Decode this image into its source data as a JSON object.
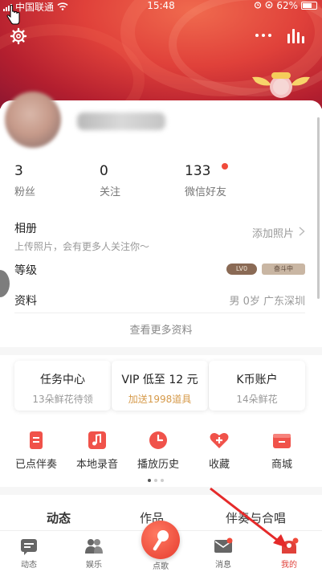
{
  "status": {
    "carrier": "中国联通",
    "time": "15:48",
    "battery": "62%"
  },
  "header": {
    "settings_icon": "gear-icon",
    "more_icon": "more-icon",
    "chart_icon": "bar-chart-icon",
    "badge_icon": "vip-wings-badge-icon"
  },
  "stats": [
    {
      "value": "3",
      "label": "粉丝"
    },
    {
      "value": "0",
      "label": "关注"
    },
    {
      "value": "133",
      "label": "微信好友"
    }
  ],
  "album": {
    "title": "相册",
    "subtitle": "上传照片，会有更多人关注你～",
    "action": "添加照片"
  },
  "level": {
    "title": "等级",
    "level_badge": "LV0",
    "status_badge": "奋斗中"
  },
  "profile": {
    "title": "资料",
    "value": "男 0岁 广东深圳"
  },
  "more_info": "查看更多资料",
  "task_cards": [
    {
      "title": "任务中心",
      "subtitle": "13朵鲜花待领"
    },
    {
      "title": "VIP 低至 12 元",
      "subtitle": "加送1998道具"
    },
    {
      "title": "K币账户",
      "subtitle": "14朵鲜花"
    }
  ],
  "functions": [
    {
      "label": "已点伴奏",
      "icon": "document-icon"
    },
    {
      "label": "本地录音",
      "icon": "music-note-icon"
    },
    {
      "label": "播放历史",
      "icon": "clock-icon"
    },
    {
      "label": "收藏",
      "icon": "heart-plus-icon"
    },
    {
      "label": "商城",
      "icon": "store-icon"
    }
  ],
  "tabs": [
    "动态",
    "作品",
    "伴奏与合唱"
  ],
  "bottom_nav": [
    {
      "label": "动态",
      "icon": "feed-icon"
    },
    {
      "label": "娱乐",
      "icon": "people-icon"
    },
    {
      "label": "点歌",
      "icon": "microphone-icon"
    },
    {
      "label": "消息",
      "icon": "mail-icon"
    },
    {
      "label": "我的",
      "icon": "profile-icon"
    }
  ],
  "colors": {
    "accent": "#e0413a",
    "banner": "#c8283a",
    "gold": "#d69a4a"
  }
}
